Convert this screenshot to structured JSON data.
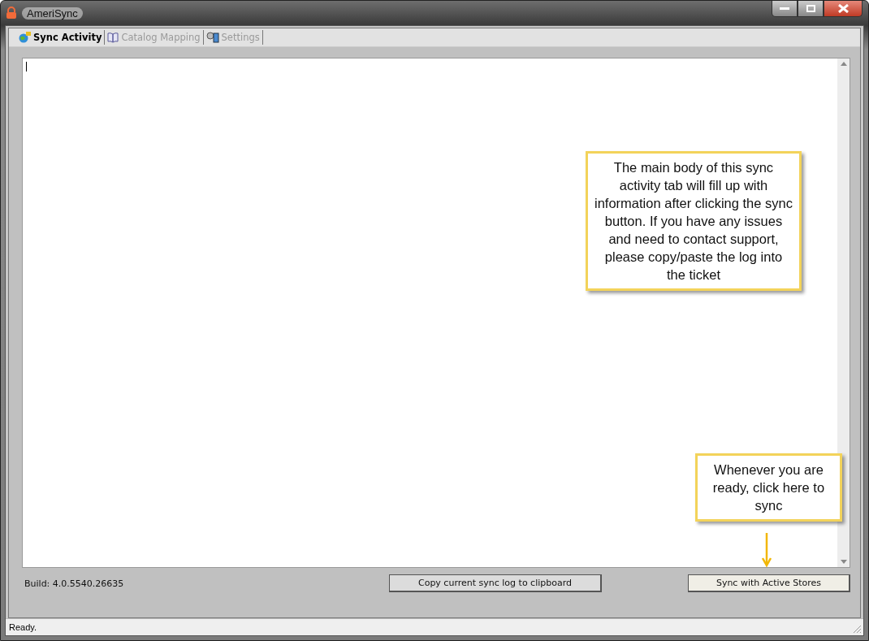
{
  "window": {
    "title": "AmeriSync"
  },
  "tabs": [
    {
      "label": "Sync Activity",
      "selected": true,
      "kind": "globe"
    },
    {
      "label": "Catalog Mapping",
      "selected": false,
      "kind": "book"
    },
    {
      "label": "Settings",
      "selected": false,
      "kind": "gears"
    }
  ],
  "callouts": [
    {
      "text": "The main body of this sync activity tab will fill up with information after clicking the sync button. If you have any issues and need to contact support, please copy/paste the log into the ticket"
    },
    {
      "text": "Whenever you are ready, click here to sync"
    }
  ],
  "build": "Build: 4.0.5540.26635",
  "buttons": [
    {
      "label": "Copy current sync log to clipboard",
      "kind": "dark"
    },
    {
      "label": "Sync with Active Stores",
      "kind": "light"
    }
  ],
  "status_bar": "Ready."
}
